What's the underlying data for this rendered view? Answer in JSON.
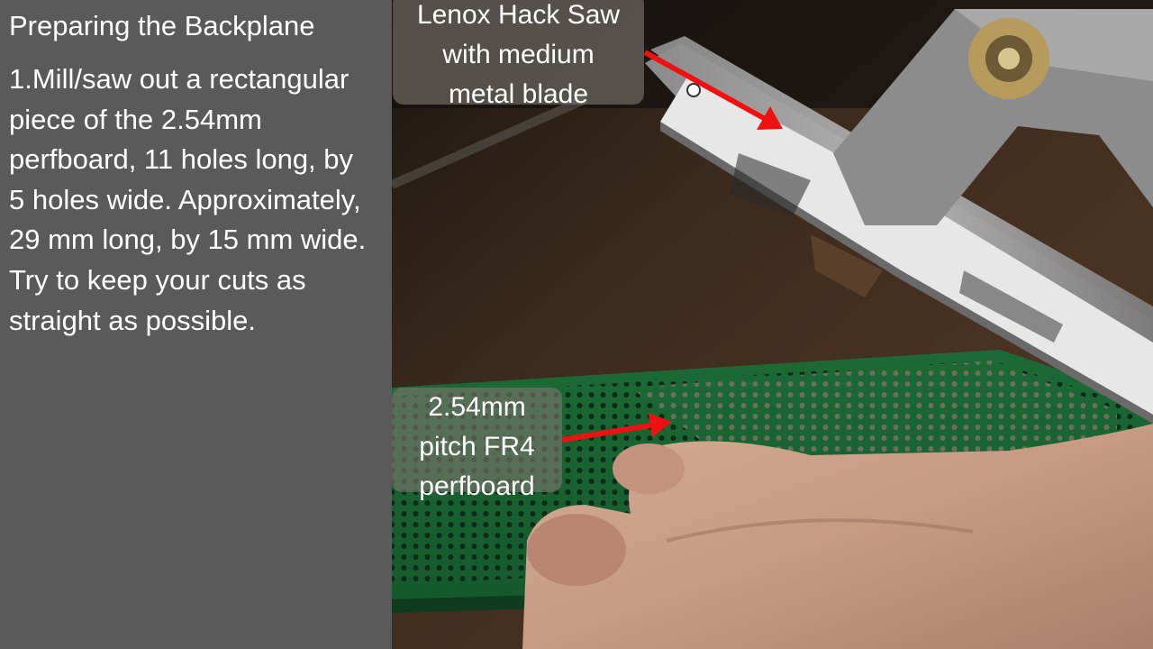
{
  "slide": {
    "title": "Preparing the Backplane",
    "body": "1.Mill/saw out a rectangular piece of the 2.54mm perfboard, 11 holes long, by 5 holes wide. Approximately, 29 mm long, by 15 mm wide.  Try to keep your cuts as straight as possible."
  },
  "photo": {
    "subject": "hacksaw cutting green perfboard held by fingers on wooden bench",
    "callouts": {
      "saw": "Lenox Hack Saw\nwith medium\nmetal blade",
      "board": "2.54mm\npitch FR4\nperfboard"
    }
  },
  "colors": {
    "sidebar": "#5a5a5a",
    "text": "#ffffff",
    "arrow": "#ee1111",
    "board": "#1f6e3a",
    "saw_frame": "#9c9c9c",
    "blade": "#e2e2e2",
    "wood": "#3a2a1e",
    "skin": "#c9a08a"
  }
}
